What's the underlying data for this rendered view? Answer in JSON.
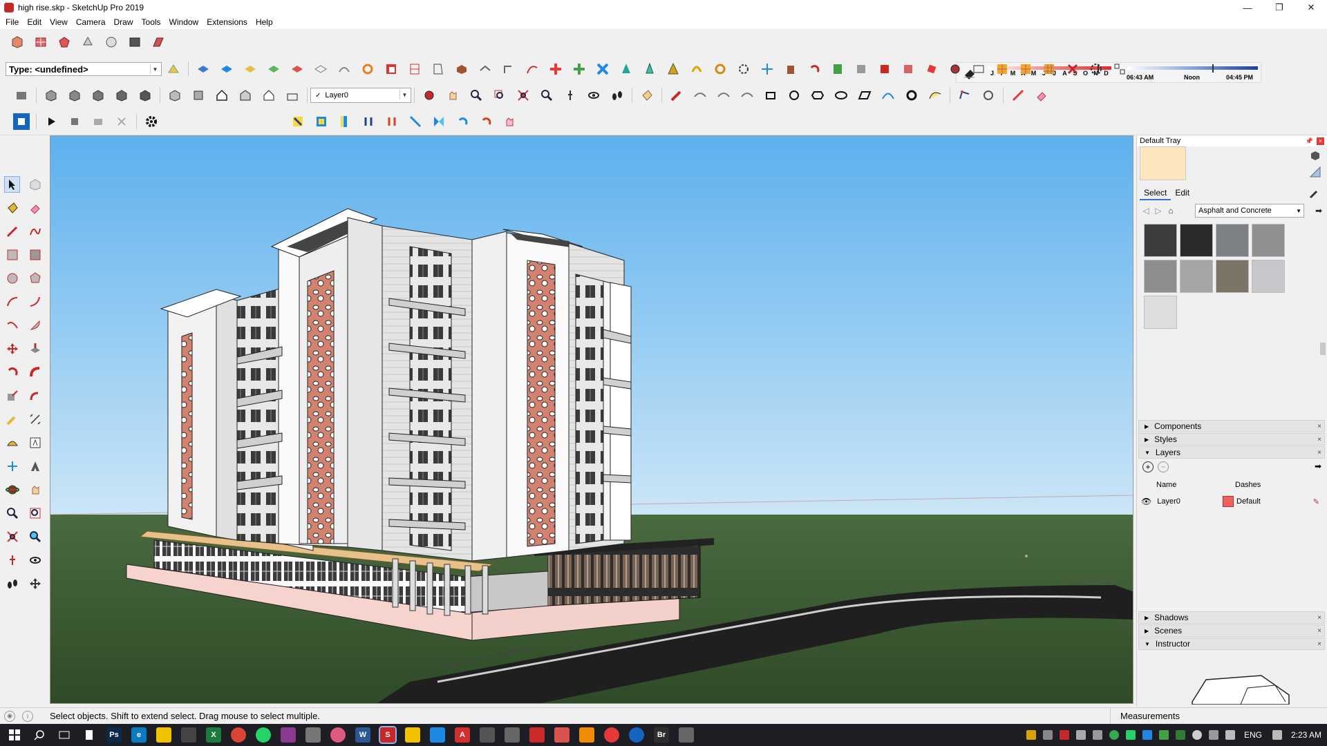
{
  "window": {
    "title": "high rise.skp - SketchUp Pro 2019",
    "controls": [
      "—",
      "❐",
      "✕"
    ]
  },
  "menu": [
    "File",
    "Edit",
    "View",
    "Camera",
    "Draw",
    "Tools",
    "Window",
    "Extensions",
    "Help"
  ],
  "toolbar": {
    "type_field": "Type: <undefined>",
    "layer_select": "Layer0"
  },
  "shadow_widget": {
    "months": [
      "J",
      "F",
      "M",
      "A",
      "M",
      "J",
      "J",
      "A",
      "S",
      "O",
      "N",
      "D"
    ],
    "time_start": "06:43 AM",
    "time_mid": "Noon",
    "time_end": "04:45 PM",
    "month_level": 0.89,
    "time_level": 0.65
  },
  "tray": {
    "title": "Default Tray",
    "tab_select": "Select",
    "tab_edit": "Edit",
    "library": "Asphalt and Concrete",
    "materials": [
      "#3d3b3e",
      "#2a2a2c",
      "#7d8084",
      "#8d8f91",
      "#8f8c8c",
      "#a4a6a5",
      "#7c7466",
      "#c6c8cc",
      "#dedede"
    ],
    "panels": {
      "components": "Components",
      "styles": "Styles",
      "layers": "Layers",
      "shadows": "Shadows",
      "scenes": "Scenes",
      "instructor": "Instructor"
    },
    "layers_table": {
      "col_name": "Name",
      "col_dashes": "Dashes",
      "row_name": "Layer0",
      "row_dashes": "Default"
    }
  },
  "status": {
    "message": "Select objects. Shift to extend select. Drag mouse to select multiple.",
    "measurements": "Measurements"
  },
  "taskbar": {
    "language": "ENG",
    "clock": "2:23 AM",
    "apps": [
      {
        "label": "Ps",
        "color": "#0b2a4a"
      },
      {
        "label": "e",
        "color": "#0a7bc2"
      },
      {
        "label": "",
        "color": "#f2c200"
      },
      {
        "label": "",
        "color": "#444"
      },
      {
        "label": "X",
        "color": "#1d7a3f"
      },
      {
        "label": "",
        "color": "#db4437"
      },
      {
        "label": "",
        "color": "#25d366"
      },
      {
        "label": "",
        "color": "#8a3b8f"
      },
      {
        "label": "",
        "color": "#777"
      },
      {
        "label": "",
        "color": "#e05a80"
      },
      {
        "label": "W",
        "color": "#2b5797"
      },
      {
        "label": "S",
        "color": "#c62828"
      },
      {
        "label": "",
        "color": "#f2c200"
      },
      {
        "label": "",
        "color": "#1e88e5"
      },
      {
        "label": "A",
        "color": "#d32f2f"
      },
      {
        "label": "",
        "color": "#555"
      },
      {
        "label": "",
        "color": "#666"
      },
      {
        "label": "",
        "color": "#cc2b2b"
      },
      {
        "label": "",
        "color": "#d9534f"
      },
      {
        "label": "",
        "color": "#f08c00"
      },
      {
        "label": "",
        "color": "#e53935"
      },
      {
        "label": "",
        "color": "#1565c0"
      },
      {
        "label": "Br",
        "color": "#2d2d2d"
      },
      {
        "label": "",
        "color": "#666"
      }
    ]
  }
}
